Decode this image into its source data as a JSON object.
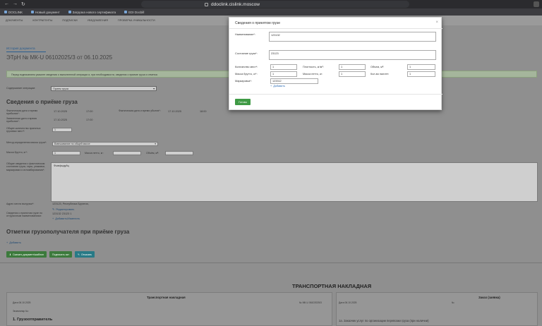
{
  "browser": {
    "url": "ddoclink.cislink.moscow/WayBill/ConsigneeView/docId=16023930",
    "app_label": "ddoclink.cislink.moscow",
    "tabs": [
      {
        "label": "DOCLINK"
      },
      {
        "label": "Новый документ"
      },
      {
        "label": "Загрузка нового сертификата"
      },
      {
        "label": "EDI Docbill"
      }
    ]
  },
  "appnav": {
    "items": [
      "Документы",
      "Контрагенты",
      "Подписки",
      "Уведомления",
      "Проверка уникальности"
    ]
  },
  "page": {
    "breadcrumb": "История документа",
    "doc_title": "ЭТрН №   МК-U 06102025/3  от   06.10.2025",
    "info_text": "Перед подписанием укажите сведения о выполненной операции и, при необходимости, сведения о приеме груза и отметки.",
    "operation_label": "Содержание операции:",
    "operation_value": "Прием груза",
    "section_receipt": "Сведения о приёме груза",
    "actual_arrival_label": "Фактическая дата и время прибытия*:",
    "actual_arrival_date": "17.10.2025",
    "actual_arrival_time": "17:00",
    "actual_departure_label": "Фактическая дата и время убытия*:",
    "actual_departure_date": "17.10.2025",
    "actual_departure_time": "18:00",
    "planned_arrival_label": "Заявленная дата и время прибытия*:",
    "planned_arrival_date": "17.10.2025",
    "planned_arrival_time": "17:00",
    "places_label": "Общее количество принятых грузовых мест*:",
    "places_value": "1",
    "weight_method_label": "Метод определения массы груза*:",
    "weight_method_value": "Взвешивание по общей массе",
    "gross_label": "Масса брутто, кг*:",
    "gross_value": "1",
    "net_label": "Масса нетто, кг:",
    "volume_label": "Объём, м³:",
    "state_label": "Общие сведения о фактическом состоянии груза, тары, упаковки, маркировки и опломбирования*:",
    "state_value": "Фывфыдуйц",
    "address_label": "Адрес места выгрузки*:",
    "address_value": "123123, Республика Бурятия,",
    "edit_link": "Редактировать",
    "cargo_info_label": "Сведения о принятом грузе по отгрузочным наименованиям:",
    "cargo_info_value": "123132 23123 1",
    "add_edit_link": "Добавить/Изменить",
    "section_marks": "Отметки грузополучателя при приёме груза",
    "add_link": "Добавить",
    "buttons": {
      "download": "Скачать документ/шаблон",
      "sign": "Подписать акт",
      "refuse": "Отказать"
    },
    "tn_heading": "ТРАНСПОРТНАЯ НАКЛАДНАЯ",
    "tn_left_title": "Транспортная накладная",
    "tn_left_date": "Дата 06.10.2025",
    "tn_left_number": "№ МК-U 06102025/3",
    "tn_left_copy": "Экземпляр №:",
    "tn_left_section": "1. Грузоотправитель",
    "tn_right_title": "Заказ (заявка)",
    "tn_right_date": "Дата 06.10.2025",
    "tn_right_number": "№",
    "tn_right_section": "1а. Заказчик услуг по организации перевозки груза (при наличии)"
  },
  "modal": {
    "title": "Сведения о принятом грузе",
    "name_label": "Наименование*:",
    "name_value": "123132",
    "state_label": "Состояние груза*:",
    "state_value": "23123",
    "qty_label": "Количество мест*:",
    "qty_value": "1",
    "density_label": "Плотность, кг/м³:",
    "density_value": "1",
    "volume_label": "Объем, м³:",
    "volume_value": "1",
    "gross_label": "Масса брутто, кг*:",
    "gross_value": "1",
    "net_label": "Масса нетто, кг:",
    "net_value": "1",
    "pallets_label": "Кол-во паллет:",
    "pallets_value": "1",
    "marking_label": "Маркировка*:",
    "marking_value": "123312",
    "add_link": "Добавить",
    "save_button": "Готово"
  },
  "colors": {
    "overlay": "#8f8f8f",
    "primary_button": "#3f9a45",
    "link": "#2a6bb5"
  }
}
